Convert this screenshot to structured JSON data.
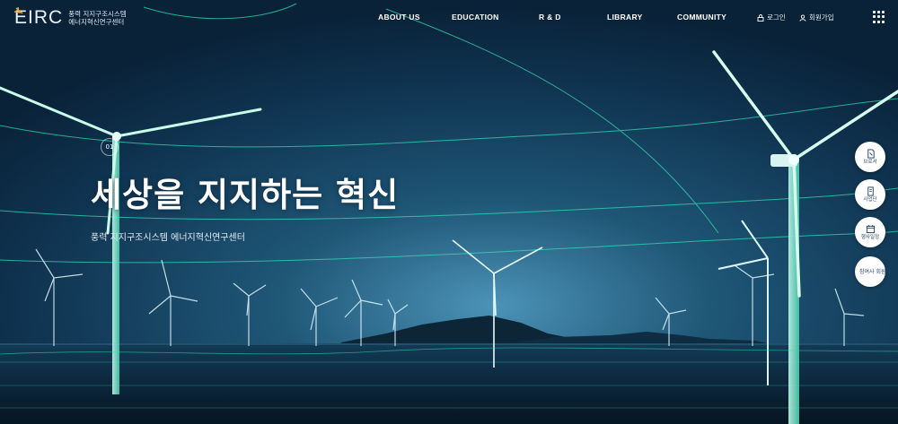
{
  "header": {
    "logo_text": "EIRC",
    "logo_line1": "풍력 지지구조시스템",
    "logo_line2": "에너지혁신연구센터",
    "nav": [
      "ABOUT US",
      "EDUCATION",
      "R & D",
      "LIBRARY",
      "COMMUNITY"
    ],
    "login": "로그인",
    "signup": "회원가입"
  },
  "hero": {
    "indicator": "01",
    "title": "세상을 지지하는 혁신",
    "subtitle": "풍력 지지구조시스템 에너지혁신연구센터"
  },
  "quick_menu": [
    {
      "label": "브로셔",
      "icon": "brochure-icon"
    },
    {
      "label": "사업단",
      "icon": "document-icon"
    },
    {
      "label": "행사일정",
      "icon": "calendar-icon"
    },
    {
      "label": "참여사 회원사",
      "icon": "members-icon"
    }
  ],
  "colors": {
    "background": "#0b2236",
    "glow": "#36e7c4",
    "sky_light": "#3f7fa5"
  }
}
